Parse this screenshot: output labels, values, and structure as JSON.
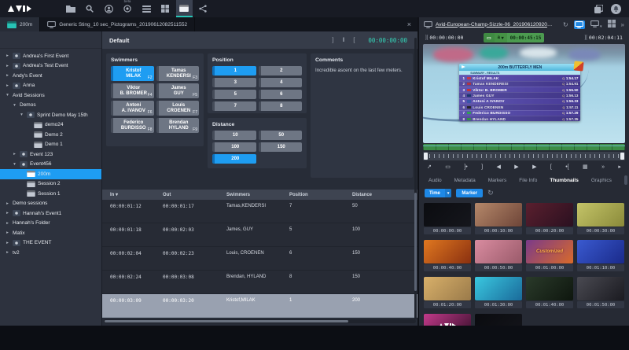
{
  "toolbar": {
    "logo": "AVID",
    "icons": [
      {
        "name": "folder"
      },
      {
        "name": "search"
      },
      {
        "name": "user"
      },
      {
        "name": "beta",
        "badge": "beta"
      },
      {
        "name": "rows"
      },
      {
        "name": "grid"
      },
      {
        "name": "slate",
        "active": true
      },
      {
        "name": "share"
      }
    ],
    "right_icons": [
      {
        "name": "apps"
      },
      {
        "name": "notifications"
      }
    ]
  },
  "tabstrip": {
    "tabs": [
      {
        "label": "200m",
        "icon": "slate",
        "active": true
      },
      {
        "label": "Generic Sting_10 sec_Pictograms_20190612082511552",
        "icon": "monitor",
        "active": false
      }
    ],
    "close_label": "×"
  },
  "sidebar": {
    "items": [
      {
        "label": "Andrea's First Event",
        "depth": 0,
        "arrow": "collapsed",
        "icon": "event"
      },
      {
        "label": "Andrea's Test Event",
        "depth": 0,
        "arrow": "collapsed",
        "icon": "event"
      },
      {
        "label": "Andy's Event",
        "depth": 0,
        "arrow": "collapsed",
        "icon": null
      },
      {
        "label": "Anna",
        "depth": 0,
        "arrow": "collapsed",
        "icon": "event"
      },
      {
        "label": "Avid Sessions",
        "depth": 0,
        "arrow": "expanded",
        "icon": null
      },
      {
        "label": "Demos",
        "depth": 1,
        "arrow": "expanded",
        "icon": null
      },
      {
        "label": "Sprint Demo May 15th",
        "depth": 2,
        "arrow": "expanded",
        "icon": "event"
      },
      {
        "label": "demo24",
        "depth": 3,
        "arrow": null,
        "icon": "clip"
      },
      {
        "label": "Demo 2",
        "depth": 3,
        "arrow": null,
        "icon": "clip"
      },
      {
        "label": "Demo 1",
        "depth": 3,
        "arrow": null,
        "icon": "clip"
      },
      {
        "label": "Event 123",
        "depth": 1,
        "arrow": "collapsed",
        "icon": "event"
      },
      {
        "label": "Event456",
        "depth": 1,
        "arrow": "expanded",
        "icon": "event"
      },
      {
        "label": "200m",
        "depth": 2,
        "arrow": null,
        "icon": "clip",
        "selected": true
      },
      {
        "label": "Session 2",
        "depth": 2,
        "arrow": null,
        "icon": "clip"
      },
      {
        "label": "Session 1",
        "depth": 2,
        "arrow": null,
        "icon": "clip"
      },
      {
        "label": "Demo sessions",
        "depth": 0,
        "arrow": "collapsed",
        "icon": null
      },
      {
        "label": "Hannah's Event1",
        "depth": 0,
        "arrow": "collapsed",
        "icon": "event"
      },
      {
        "label": "Hannah's Folder",
        "depth": 0,
        "arrow": "collapsed",
        "icon": null
      },
      {
        "label": "Matix",
        "depth": 0,
        "arrow": "collapsed",
        "icon": null
      },
      {
        "label": "THE EVENT",
        "depth": 0,
        "arrow": "collapsed",
        "icon": "event"
      },
      {
        "label": "tv2",
        "depth": 0,
        "arrow": "collapsed",
        "icon": null
      }
    ]
  },
  "logger": {
    "template": {
      "name": "Default"
    },
    "header": {
      "timecode": "00:00:00:00",
      "mark_icons": [
        "]",
        "‖",
        "["
      ]
    },
    "sections": {
      "swimmers": {
        "title": "Swimmers",
        "buttons": [
          {
            "first": "Kristof",
            "last": "MILAK",
            "key": "F2",
            "selected": true
          },
          {
            "first": "Tamas",
            "last": "KENDERSI",
            "key": "F3"
          },
          {
            "first": "Viktor",
            "last": "B. BROMER",
            "key": "F4"
          },
          {
            "first": "James",
            "last": "GUY",
            "key": "F5"
          },
          {
            "first": "Antoni",
            "last": "A. IVANOV",
            "key": "F6"
          },
          {
            "first": "Louis",
            "last": "CROENEN",
            "key": "F7"
          },
          {
            "first": "Federico",
            "last": "BURDISSO",
            "key": "F8"
          },
          {
            "first": "Brendan",
            "last": "HYLAND",
            "key": "F9"
          }
        ]
      },
      "position": {
        "title": "Position",
        "values": [
          "1",
          "2",
          "3",
          "4",
          "5",
          "6",
          "7",
          "8"
        ],
        "selected": "1"
      },
      "distance": {
        "title": "Distance",
        "values": [
          "10",
          "50",
          "100",
          "150",
          "200"
        ],
        "selected": "200"
      },
      "comments": {
        "title": "Comments",
        "text": "Incredible ascent on the last few meters."
      }
    },
    "table": {
      "columns": [
        "In",
        "Out",
        "Swimmers",
        "Position",
        "Distance"
      ],
      "sort_column": "In",
      "rows": [
        {
          "in": "00:00:01:12",
          "out": "00:00:01:17",
          "swimmer": "Tamas,KENDERSI",
          "position": "7",
          "distance": "50"
        },
        {
          "in": "00:00:01:18",
          "out": "00:00:02:03",
          "swimmer": "James, GUY",
          "position": "5",
          "distance": "100"
        },
        {
          "in": "00:00:02:04",
          "out": "00:00:02:23",
          "swimmer": "Louis, CROENEN",
          "position": "6",
          "distance": "150"
        },
        {
          "in": "00:00:02:24",
          "out": "00:00:03:08",
          "swimmer": "Brendan, HYLAND",
          "position": "8",
          "distance": "150"
        },
        {
          "in": "00:00:03:09",
          "out": "00:00:03:20",
          "swimmer": "Kristof,MILAK",
          "position": "1",
          "distance": "200",
          "selected": true
        }
      ]
    }
  },
  "player": {
    "asset_name": "Avid-European-Champ-Sizzle-06_20190612092049914...",
    "header_icons": [
      {
        "name": "refresh"
      },
      {
        "name": "monitor",
        "active": true
      },
      {
        "name": "monitor-menu"
      },
      {
        "name": "grid"
      },
      {
        "name": "more"
      }
    ],
    "timecodes": {
      "mark_in": "00:00:00:00",
      "position": "00:00:45:15",
      "duration": "00:02:04:11",
      "audio_label": "a"
    },
    "overlay": {
      "title": "200m BUTTERFLY MEN",
      "subtitle": "SUMMARY - RESULTS",
      "results": [
        {
          "rank": "1",
          "flag": "#c0394b",
          "name": "Kristof MILAK",
          "q": "q",
          "time": "1:54.17"
        },
        {
          "rank": "2",
          "flag": "#c0394b",
          "name": "Tamas KENDERESI",
          "q": "q",
          "time": "1:54.91"
        },
        {
          "rank": "3",
          "flag": "#c23038",
          "name": "Viktor B. BROMER",
          "q": "q",
          "time": "1:55.50"
        },
        {
          "rank": "4",
          "flag": "#1e3c7a",
          "name": "James GUY",
          "q": "q",
          "time": "1:56.13"
        },
        {
          "rank": "5",
          "flag": "#3a55a8",
          "name": "Antoni A IVANOV",
          "q": "q",
          "time": "1:56.33"
        },
        {
          "rank": "6",
          "flag": "#2a2a2e",
          "name": "Louis CROENEN",
          "q": "q",
          "time": "1:57.11"
        },
        {
          "rank": "7",
          "flag": "#2f9e57",
          "name": "Federico BURDISSO",
          "q": "q",
          "time": "1:57.29"
        },
        {
          "rank": "8",
          "flag": "#3a9e4f",
          "name": "Brendan HYLAND",
          "q": "q",
          "time": "1:57.35"
        }
      ]
    },
    "transport": [
      "send",
      "monitor",
      "goto-previous",
      "mark-out",
      "step-back",
      "play",
      "step-forward",
      "mark-in",
      "goto-next",
      "captions",
      "fast-forward",
      "next"
    ],
    "tabs": [
      {
        "label": "Audio"
      },
      {
        "label": "Metadata"
      },
      {
        "label": "Markers"
      },
      {
        "label": "File Info"
      },
      {
        "label": "Thumbnails",
        "active": true
      },
      {
        "label": "Graphics"
      }
    ],
    "filters": {
      "time_label": "Time",
      "marker_label": "Marker"
    },
    "thumbnails": [
      {
        "tc": "00:00:00:00",
        "c1": "#0b0c10",
        "c2": "#15161c"
      },
      {
        "tc": "00:00:10:00",
        "c1": "#b5886a",
        "c2": "#6e4538"
      },
      {
        "tc": "00:00:20:00",
        "c1": "#5a1f2e",
        "c2": "#2a1020"
      },
      {
        "tc": "00:00:30:00",
        "c1": "#c4c468",
        "c2": "#8a8a3a"
      },
      {
        "tc": "00:00:40:00",
        "c1": "#e07820",
        "c2": "#8a3010"
      },
      {
        "tc": "00:00:50:00",
        "c1": "#d98ca0",
        "c2": "#9a5a6a"
      },
      {
        "tc": "00:01:00:00",
        "c1": "#7a3a8a",
        "c2": "#d86a2a",
        "text": "Customized"
      },
      {
        "tc": "00:01:10:00",
        "c1": "#3a5ad0",
        "c2": "#1a2a8a"
      },
      {
        "tc": "00:01:20:00",
        "c1": "#d8b06a",
        "c2": "#9a7a4a"
      },
      {
        "tc": "00:01:30:00",
        "c1": "#3ac8e0",
        "c2": "#1a6a9a"
      },
      {
        "tc": "00:01:40:00",
        "c1": "#2a3a2a",
        "c2": "#0e160e"
      },
      {
        "tc": "00:01:50:00",
        "c1": "#4a4a52",
        "c2": "#1a1a20"
      },
      {
        "tc": "",
        "c1": "#c23a8a",
        "c2": "#38102c",
        "logo": true
      },
      {
        "tc": "",
        "c1": "#0a0b0f",
        "c2": "#14151b"
      }
    ]
  },
  "colors": {
    "accent_blue": "#1e9df2",
    "accent_teal": "#27c4b6",
    "badge_green": "#4c9b50"
  }
}
